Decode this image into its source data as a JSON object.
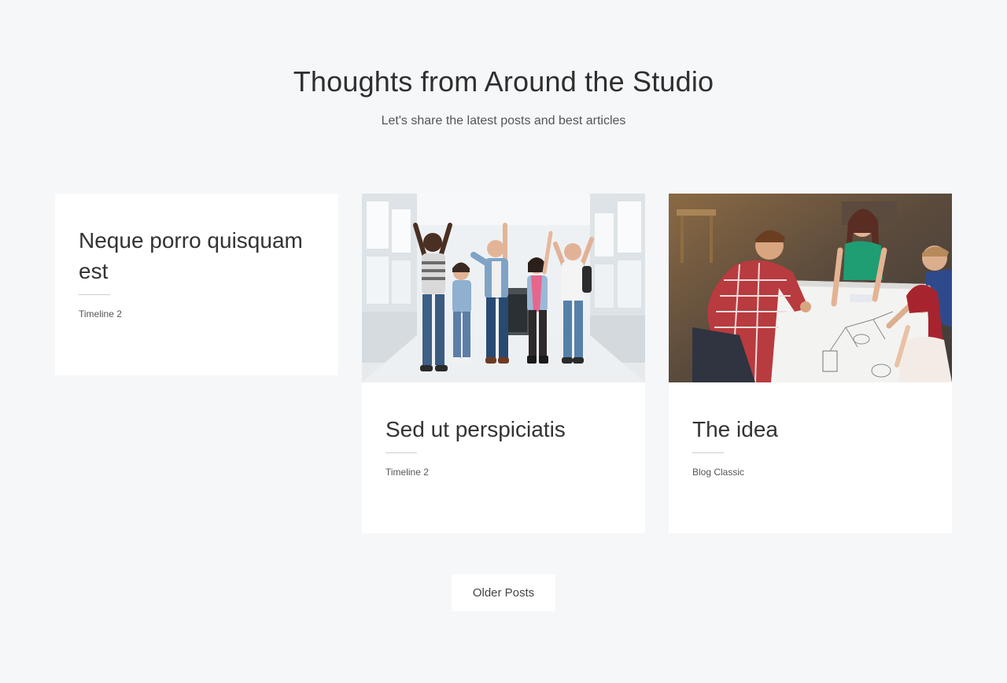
{
  "header": {
    "title": "Thoughts from Around the Studio",
    "subtitle": "Let's share the latest posts and best articles"
  },
  "posts": [
    {
      "title": "Neque porro quisquam est",
      "category": "Timeline 2",
      "image": null
    },
    {
      "title": "Sed ut perspiciatis",
      "category": "Timeline 2",
      "image": "students-jumping-in-hallway"
    },
    {
      "title": "The idea",
      "category": "Blog Classic",
      "image": "team-brainstorming-at-whiteboard-table"
    }
  ],
  "pagination": {
    "older_label": "Older Posts"
  },
  "colors": {
    "background": "#f6f7f9",
    "card": "#ffffff",
    "text": "#333333"
  }
}
